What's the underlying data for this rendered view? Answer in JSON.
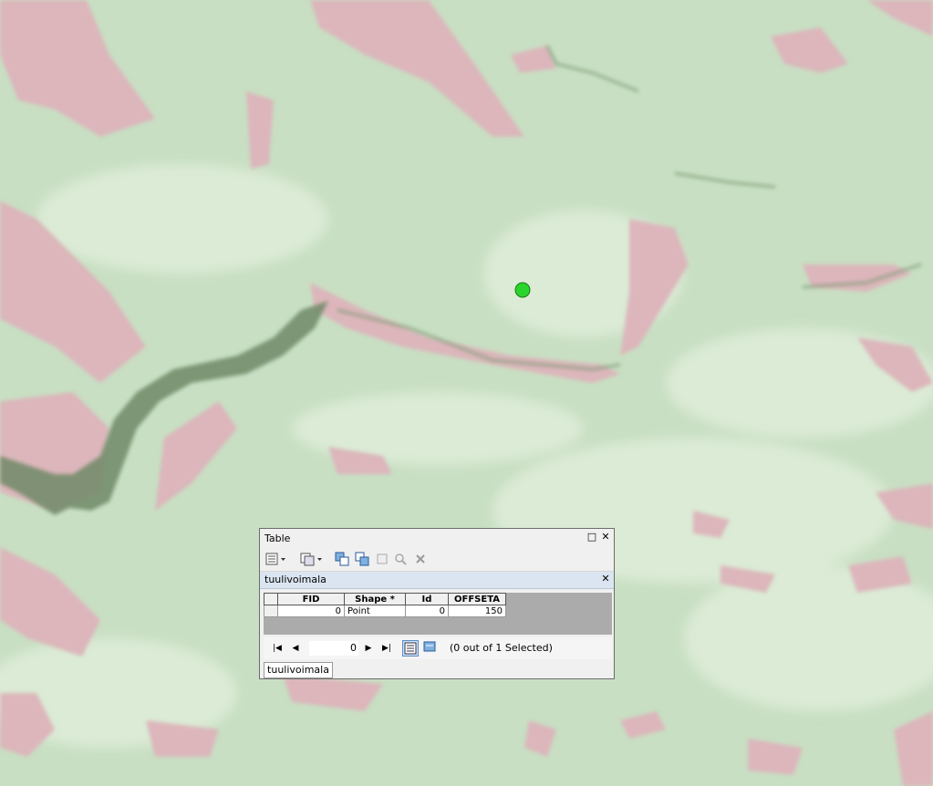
{
  "map": {
    "colors": {
      "base": "#c8dfc3",
      "pink": "#dcb6bb",
      "dark": "#6f8a68",
      "point": "#2bd42b"
    }
  },
  "window": {
    "title": "Table",
    "restore_icon": "□",
    "close_icon": "✕",
    "layer_name": "tuulivoimala",
    "layer_close_icon": "✕",
    "columns": [
      "FID",
      "Shape *",
      "Id",
      "OFFSETA"
    ],
    "rows": [
      {
        "fid": "0",
        "shape": "Point",
        "id": "0",
        "offseta": "150"
      }
    ],
    "record_number": "0",
    "selection_text": "(0 out of 1 Selected)",
    "tab_label": "tuulivoimala",
    "nav_icons": {
      "first": "|◀",
      "prev": "◀",
      "next": "▶",
      "last": "▶|"
    }
  }
}
